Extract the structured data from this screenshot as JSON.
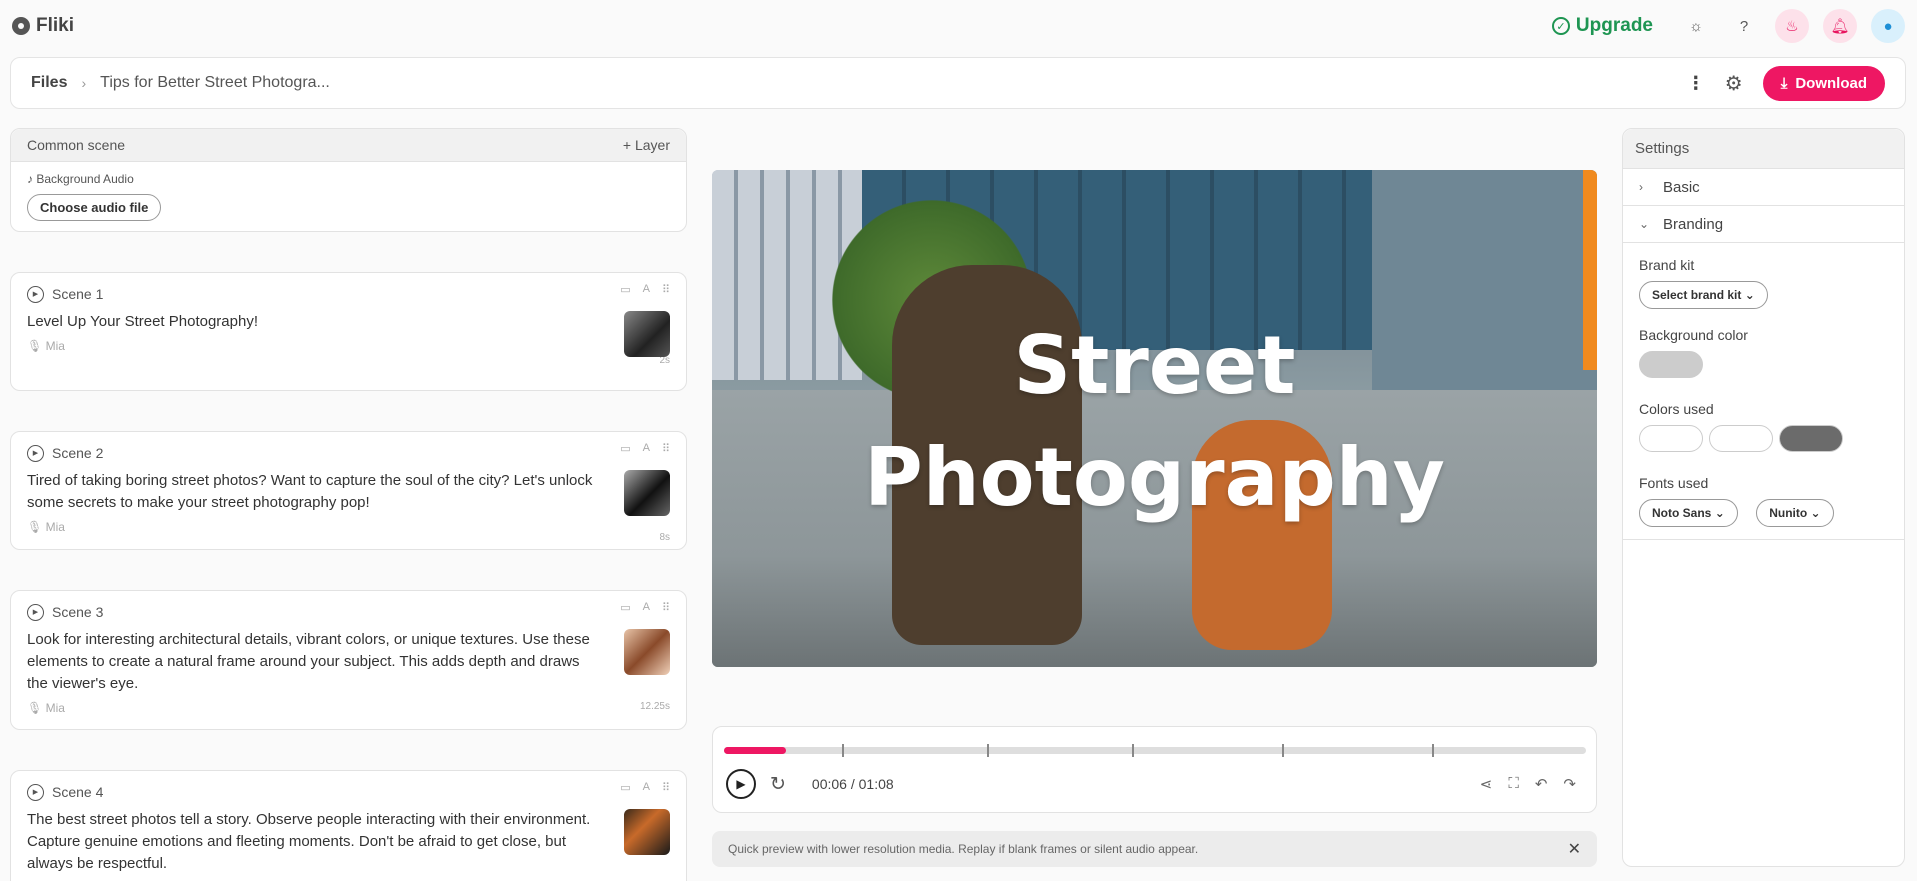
{
  "app": {
    "name": "Fliki"
  },
  "topbar": {
    "upgrade_label": "Upgrade"
  },
  "breadcrumb": {
    "root": "Files",
    "separator": "›",
    "file": "Tips for Better Street Photogra..."
  },
  "toolbar": {
    "download_label": "Download"
  },
  "common_scene": {
    "title": "Common scene",
    "layer_label": "+ Layer",
    "bg_audio_label": "Background Audio",
    "choose_audio_label": "Choose audio file"
  },
  "scenes": [
    {
      "title": "Scene 1",
      "text": "Level Up Your Street Photography!",
      "voice": "Mia",
      "duration": "2s"
    },
    {
      "title": "Scene 2",
      "text": "Tired of taking boring street photos? Want to capture the soul of the city? Let's unlock some secrets to make your street photography pop!",
      "voice": "Mia",
      "duration": "8s"
    },
    {
      "title": "Scene 3",
      "text": "Look for interesting architectural details, vibrant colors, or unique textures. Use these elements to create a natural frame around your subject. This adds depth and draws the viewer's eye.",
      "voice": "Mia",
      "duration": "12.25s"
    },
    {
      "title": "Scene 4",
      "text": "The best street photos tell a story. Observe people interacting with their environment. Capture genuine emotions and fleeting moments. Don't be afraid to get close, but always be respectful.",
      "voice": "",
      "duration": ""
    }
  ],
  "preview": {
    "title_line1": "Street",
    "title_line2": "Photography"
  },
  "player": {
    "time": "00:06 / 01:08",
    "progress": 0.072
  },
  "notice": {
    "text": "Quick preview with lower resolution media. Replay if blank frames or silent audio appear."
  },
  "settings": {
    "title": "Settings",
    "basic_label": "Basic",
    "branding_label": "Branding",
    "brand_kit_label": "Brand kit",
    "brand_kit_select": "Select brand kit",
    "bg_color_label": "Background color",
    "bg_color": "#cccccc",
    "colors_used_label": "Colors used",
    "colors_used": [
      "#ffffff",
      "#ffffff",
      "#6b6b6b"
    ],
    "fonts_used_label": "Fonts used",
    "fonts_used": [
      "Noto Sans",
      "Nunito"
    ]
  },
  "colors": {
    "accent": "#ee1763",
    "upgrade": "#1e9552"
  },
  "icons": [
    "gear-icon",
    "check-circle-icon",
    "sun-icon",
    "help-icon",
    "flame-icon",
    "bell-icon",
    "user-icon",
    "more-vertical-icon",
    "download-icon",
    "play-circle-icon",
    "image-icon",
    "text-icon",
    "drag-icon",
    "mic-icon",
    "replay-icon",
    "share-icon",
    "fullscreen-icon",
    "undo-icon",
    "redo-icon",
    "close-icon",
    "chevron-right-icon",
    "chevron-down-icon"
  ]
}
